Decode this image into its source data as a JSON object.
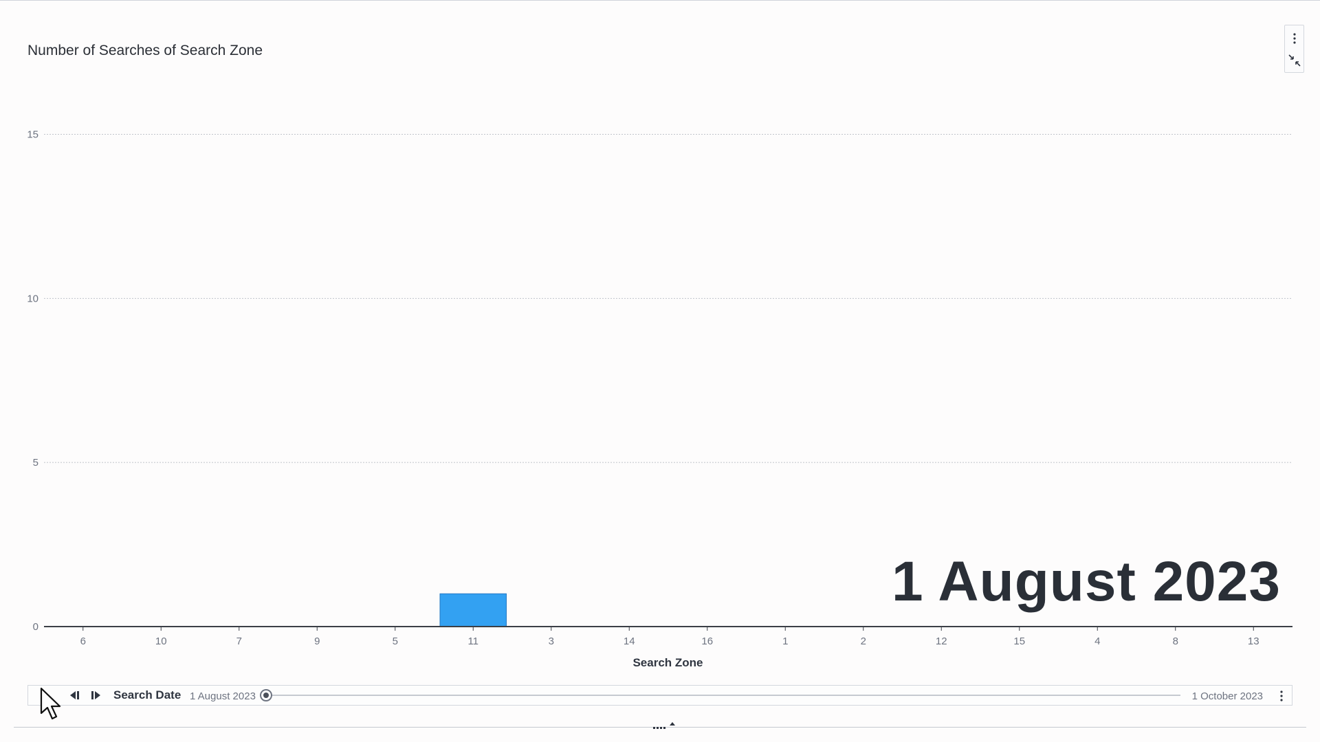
{
  "chart": {
    "title": "Number of Searches of Search Zone",
    "big_date": "1 August 2023",
    "x_axis_title": "Search Zone"
  },
  "timeline": {
    "label": "Search Date",
    "start": "1 August 2023",
    "end": "1 October 2023",
    "position": 0
  },
  "colors": {
    "bar": "#33a1f2",
    "bar_border": "#2478c4",
    "grid": "#bfc3c9",
    "axis": "#3b3f46",
    "tick_text": "#6d7380"
  },
  "icons": {
    "more": "more-vertical-icon",
    "collapse": "collapse-icon",
    "play": "play-icon",
    "step_back": "step-back-icon",
    "step_forward": "step-forward-icon",
    "timeline_more": "more-vertical-icon",
    "resize": "resize-handle-icon",
    "cursor": "mouse-pointer-icon"
  },
  "chart_data": {
    "type": "bar",
    "title": "Number of Searches of Search Zone",
    "xlabel": "Search Zone",
    "ylabel": "",
    "categories": [
      "6",
      "10",
      "7",
      "9",
      "5",
      "11",
      "3",
      "14",
      "16",
      "1",
      "2",
      "12",
      "15",
      "4",
      "8",
      "13"
    ],
    "values": [
      0,
      0,
      0,
      0,
      0,
      1,
      0,
      0,
      0,
      0,
      0,
      0,
      0,
      0,
      0,
      0
    ],
    "ylim": [
      0,
      17
    ],
    "yticks": [
      0,
      5,
      10,
      15
    ],
    "grid": true,
    "legend": "none"
  }
}
